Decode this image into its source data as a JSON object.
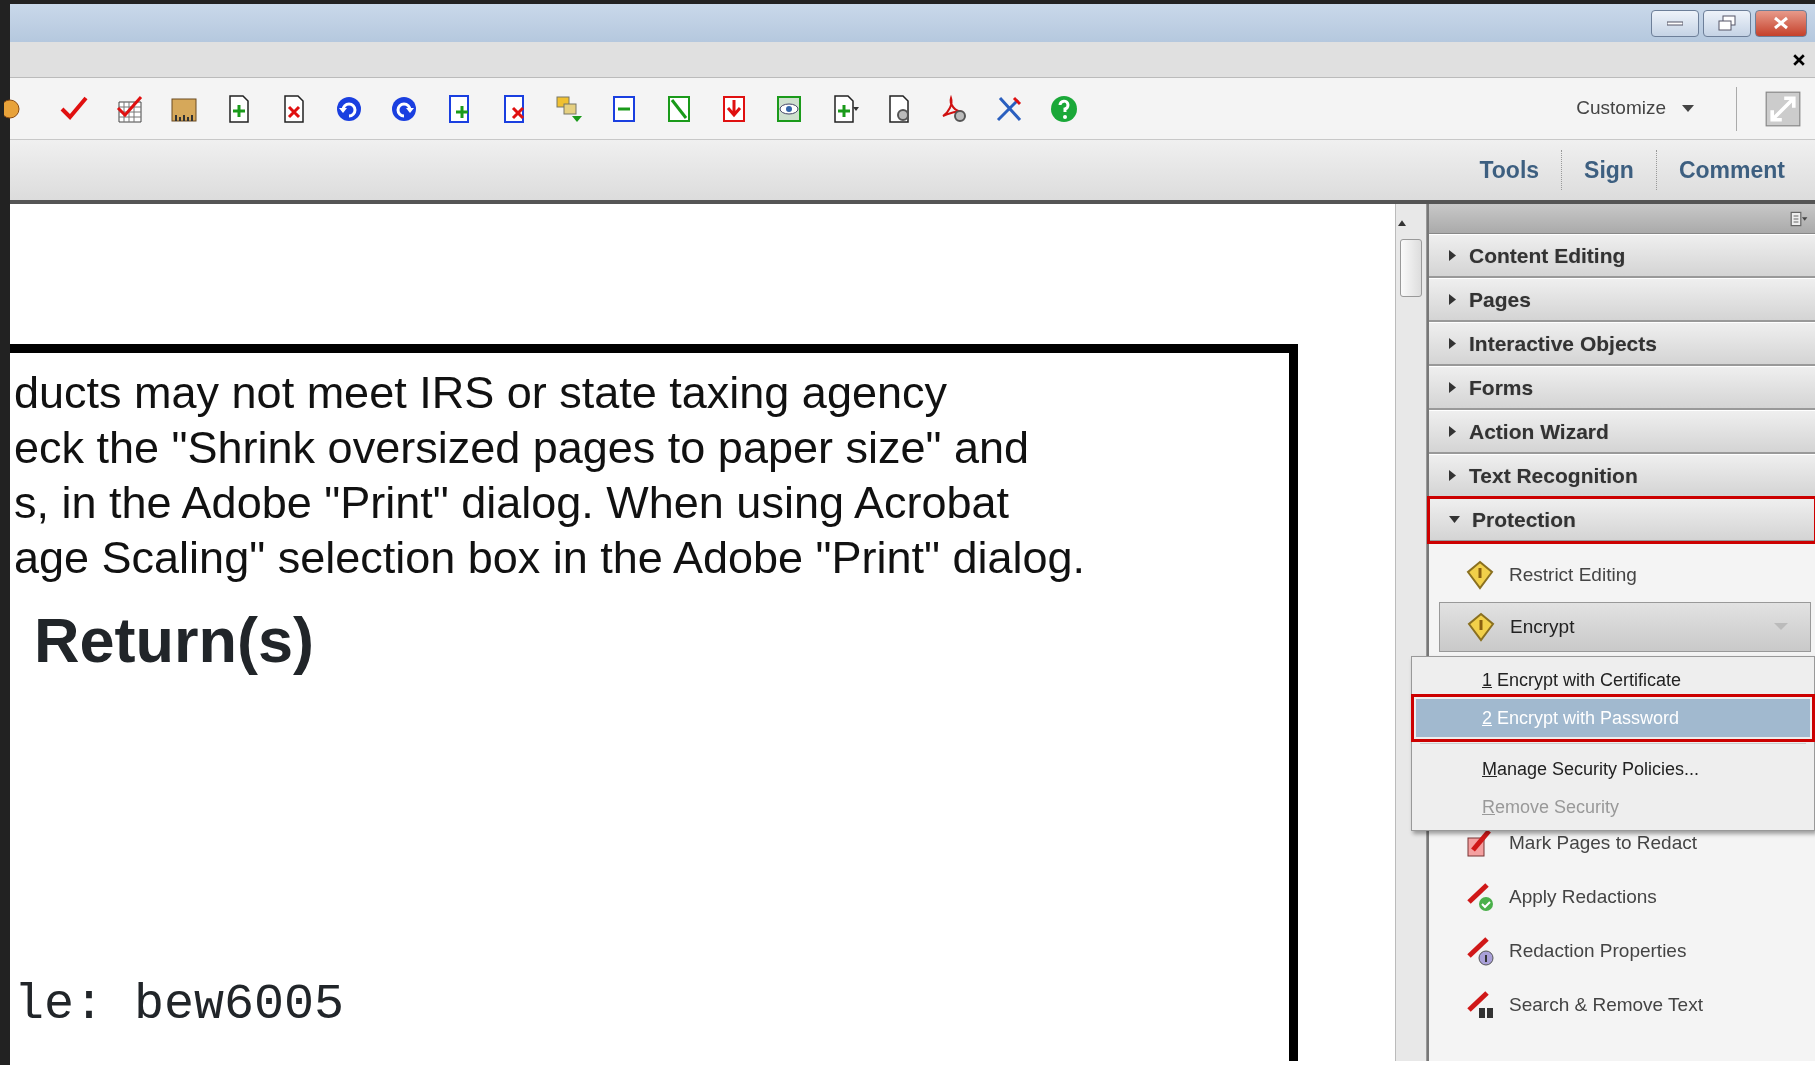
{
  "toolbar": {
    "customize": "Customize"
  },
  "tabs": [
    {
      "label": "Tools"
    },
    {
      "label": "Sign"
    },
    {
      "label": "Comment"
    }
  ],
  "document": {
    "lines": [
      "ducts may not meet IRS or state taxing agency",
      "eck the \"Shrink oversized pages to paper size\" and",
      "s, in the Adobe \"Print\" dialog.  When using Acrobat",
      "age Scaling\" selection box in the Adobe \"Print\" dialog."
    ],
    "heading": "Return(s)",
    "mono_lines": [
      "le: bew6005"
    ]
  },
  "panel": {
    "sections": [
      {
        "label": "Content Editing",
        "expanded": false,
        "outlined": false
      },
      {
        "label": "Pages",
        "expanded": false,
        "outlined": false
      },
      {
        "label": "Interactive Objects",
        "expanded": false,
        "outlined": false
      },
      {
        "label": "Forms",
        "expanded": false,
        "outlined": false
      },
      {
        "label": "Action Wizard",
        "expanded": false,
        "outlined": false
      },
      {
        "label": "Text Recognition",
        "expanded": false,
        "outlined": false
      },
      {
        "label": "Protection",
        "expanded": true,
        "outlined": true,
        "items": [
          {
            "label": "Restrict Editing",
            "kind": "tool"
          },
          {
            "label": "Encrypt",
            "kind": "dropdown"
          },
          {
            "label": "Mark Pages to Redact",
            "kind": "tool"
          },
          {
            "label": "Apply Redactions",
            "kind": "tool"
          },
          {
            "label": "Redaction Properties",
            "kind": "tool"
          },
          {
            "label": "Search & Remove Text",
            "kind": "tool"
          }
        ]
      }
    ],
    "menu": {
      "items": [
        {
          "label": "1 Encrypt with Certificate",
          "selected": false,
          "disabled": false,
          "outlined": false
        },
        {
          "label": "2 Encrypt with Password",
          "selected": true,
          "disabled": false,
          "outlined": true
        },
        {
          "label": "Manage Security Policies...",
          "selected": false,
          "disabled": false,
          "outlined": false
        },
        {
          "label": "Remove Security",
          "selected": false,
          "disabled": true,
          "outlined": false
        }
      ]
    }
  }
}
